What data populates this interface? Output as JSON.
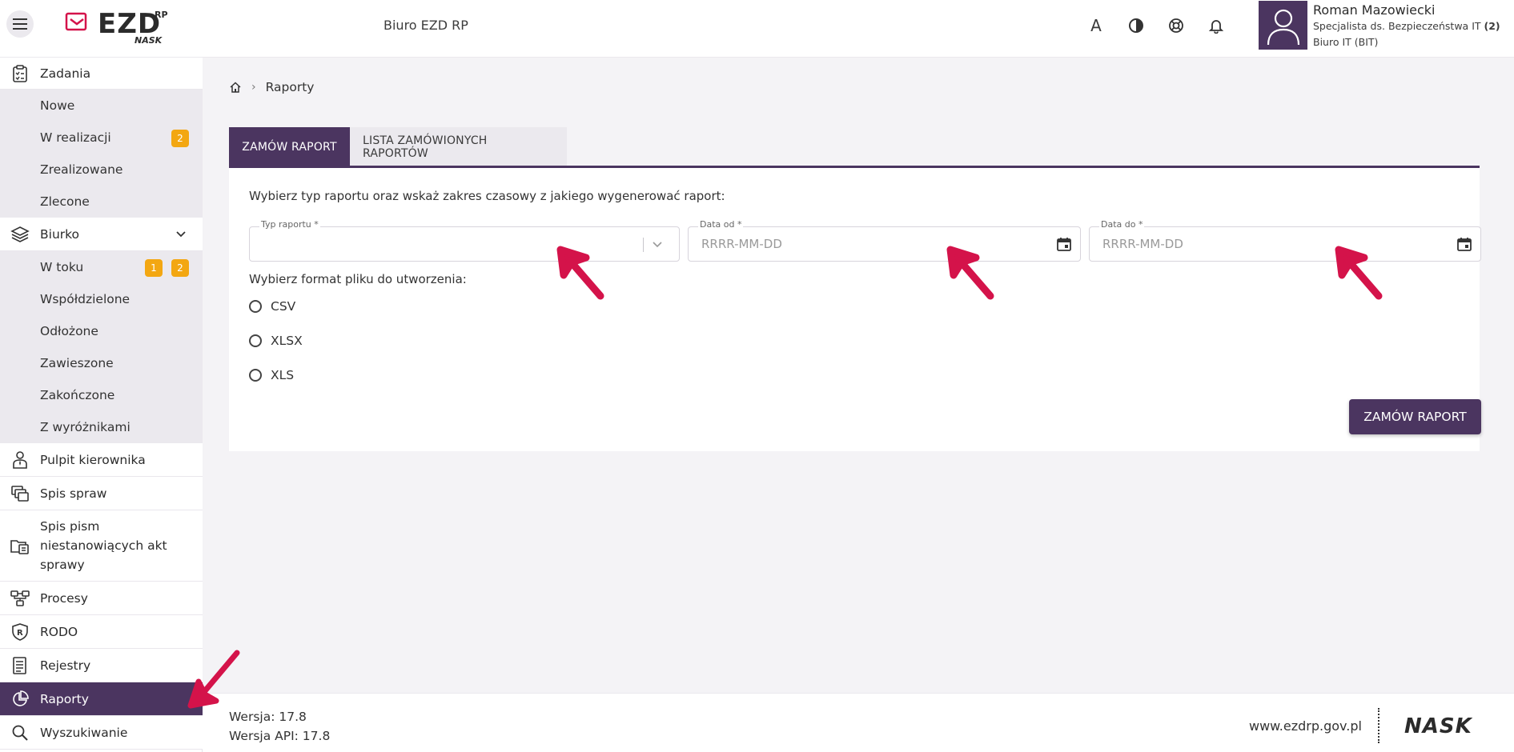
{
  "header": {
    "logo_text": "EZD",
    "logo_sup": "RP",
    "logo_sub": "NASK",
    "office": "Biuro EZD RP",
    "font_icon_glyph": "A",
    "user": {
      "name": "Roman Mazowiecki",
      "role": "Specjalista ds. Bezpieczeństwa IT",
      "role_count": "(2)",
      "department": "Biuro IT (BIT)"
    }
  },
  "sidebar": {
    "zadania": {
      "label": "Zadania",
      "items": [
        {
          "label": "Nowe"
        },
        {
          "label": "W realizacji",
          "count": "2"
        },
        {
          "label": "Zrealizowane"
        },
        {
          "label": "Zlecone"
        }
      ]
    },
    "biurko": {
      "label": "Biurko",
      "items": [
        {
          "label": "W toku",
          "count1": "1",
          "count2": "2"
        },
        {
          "label": "Współdzielone"
        },
        {
          "label": "Odłożone"
        },
        {
          "label": "Zawieszone"
        },
        {
          "label": "Zakończone"
        },
        {
          "label": "Z wyróżnikami"
        }
      ]
    },
    "pulpit": "Pulpit kierownika",
    "spis_spraw": "Spis spraw",
    "spis_pism": "Spis pism niestanowiących akt sprawy",
    "procesy": "Procesy",
    "rodo": "RODO",
    "rejestry": "Rejestry",
    "raporty": "Raporty",
    "wyszukiwanie": "Wyszukiwanie"
  },
  "breadcrumb": {
    "current": "Raporty"
  },
  "tabs": {
    "order": "ZAMÓW RAPORT",
    "list": "LISTA ZAMÓWIONYCH RAPORTÓW"
  },
  "form": {
    "instruction": "Wybierz typ raportu oraz wskaż zakres czasowy z jakiego wygenerować raport:",
    "report_type_label": "Typ raportu *",
    "date_from_label": "Data od *",
    "date_from_placeholder": "RRRR-MM-DD",
    "date_to_label": "Data do *",
    "date_to_placeholder": "RRRR-MM-DD",
    "format_label": "Wybierz format pliku do utworzenia:",
    "formats": [
      "CSV",
      "XLSX",
      "XLS"
    ],
    "submit": "ZAMÓW RAPORT"
  },
  "footer": {
    "version": "Wersja: 17.8",
    "api_version": "Wersja API: 17.8",
    "site": "www.ezdrp.gov.pl",
    "brand": "NASK"
  },
  "colors": {
    "primary": "#4b3560",
    "badge": "#f3a712",
    "arrow": "#d4134a"
  }
}
